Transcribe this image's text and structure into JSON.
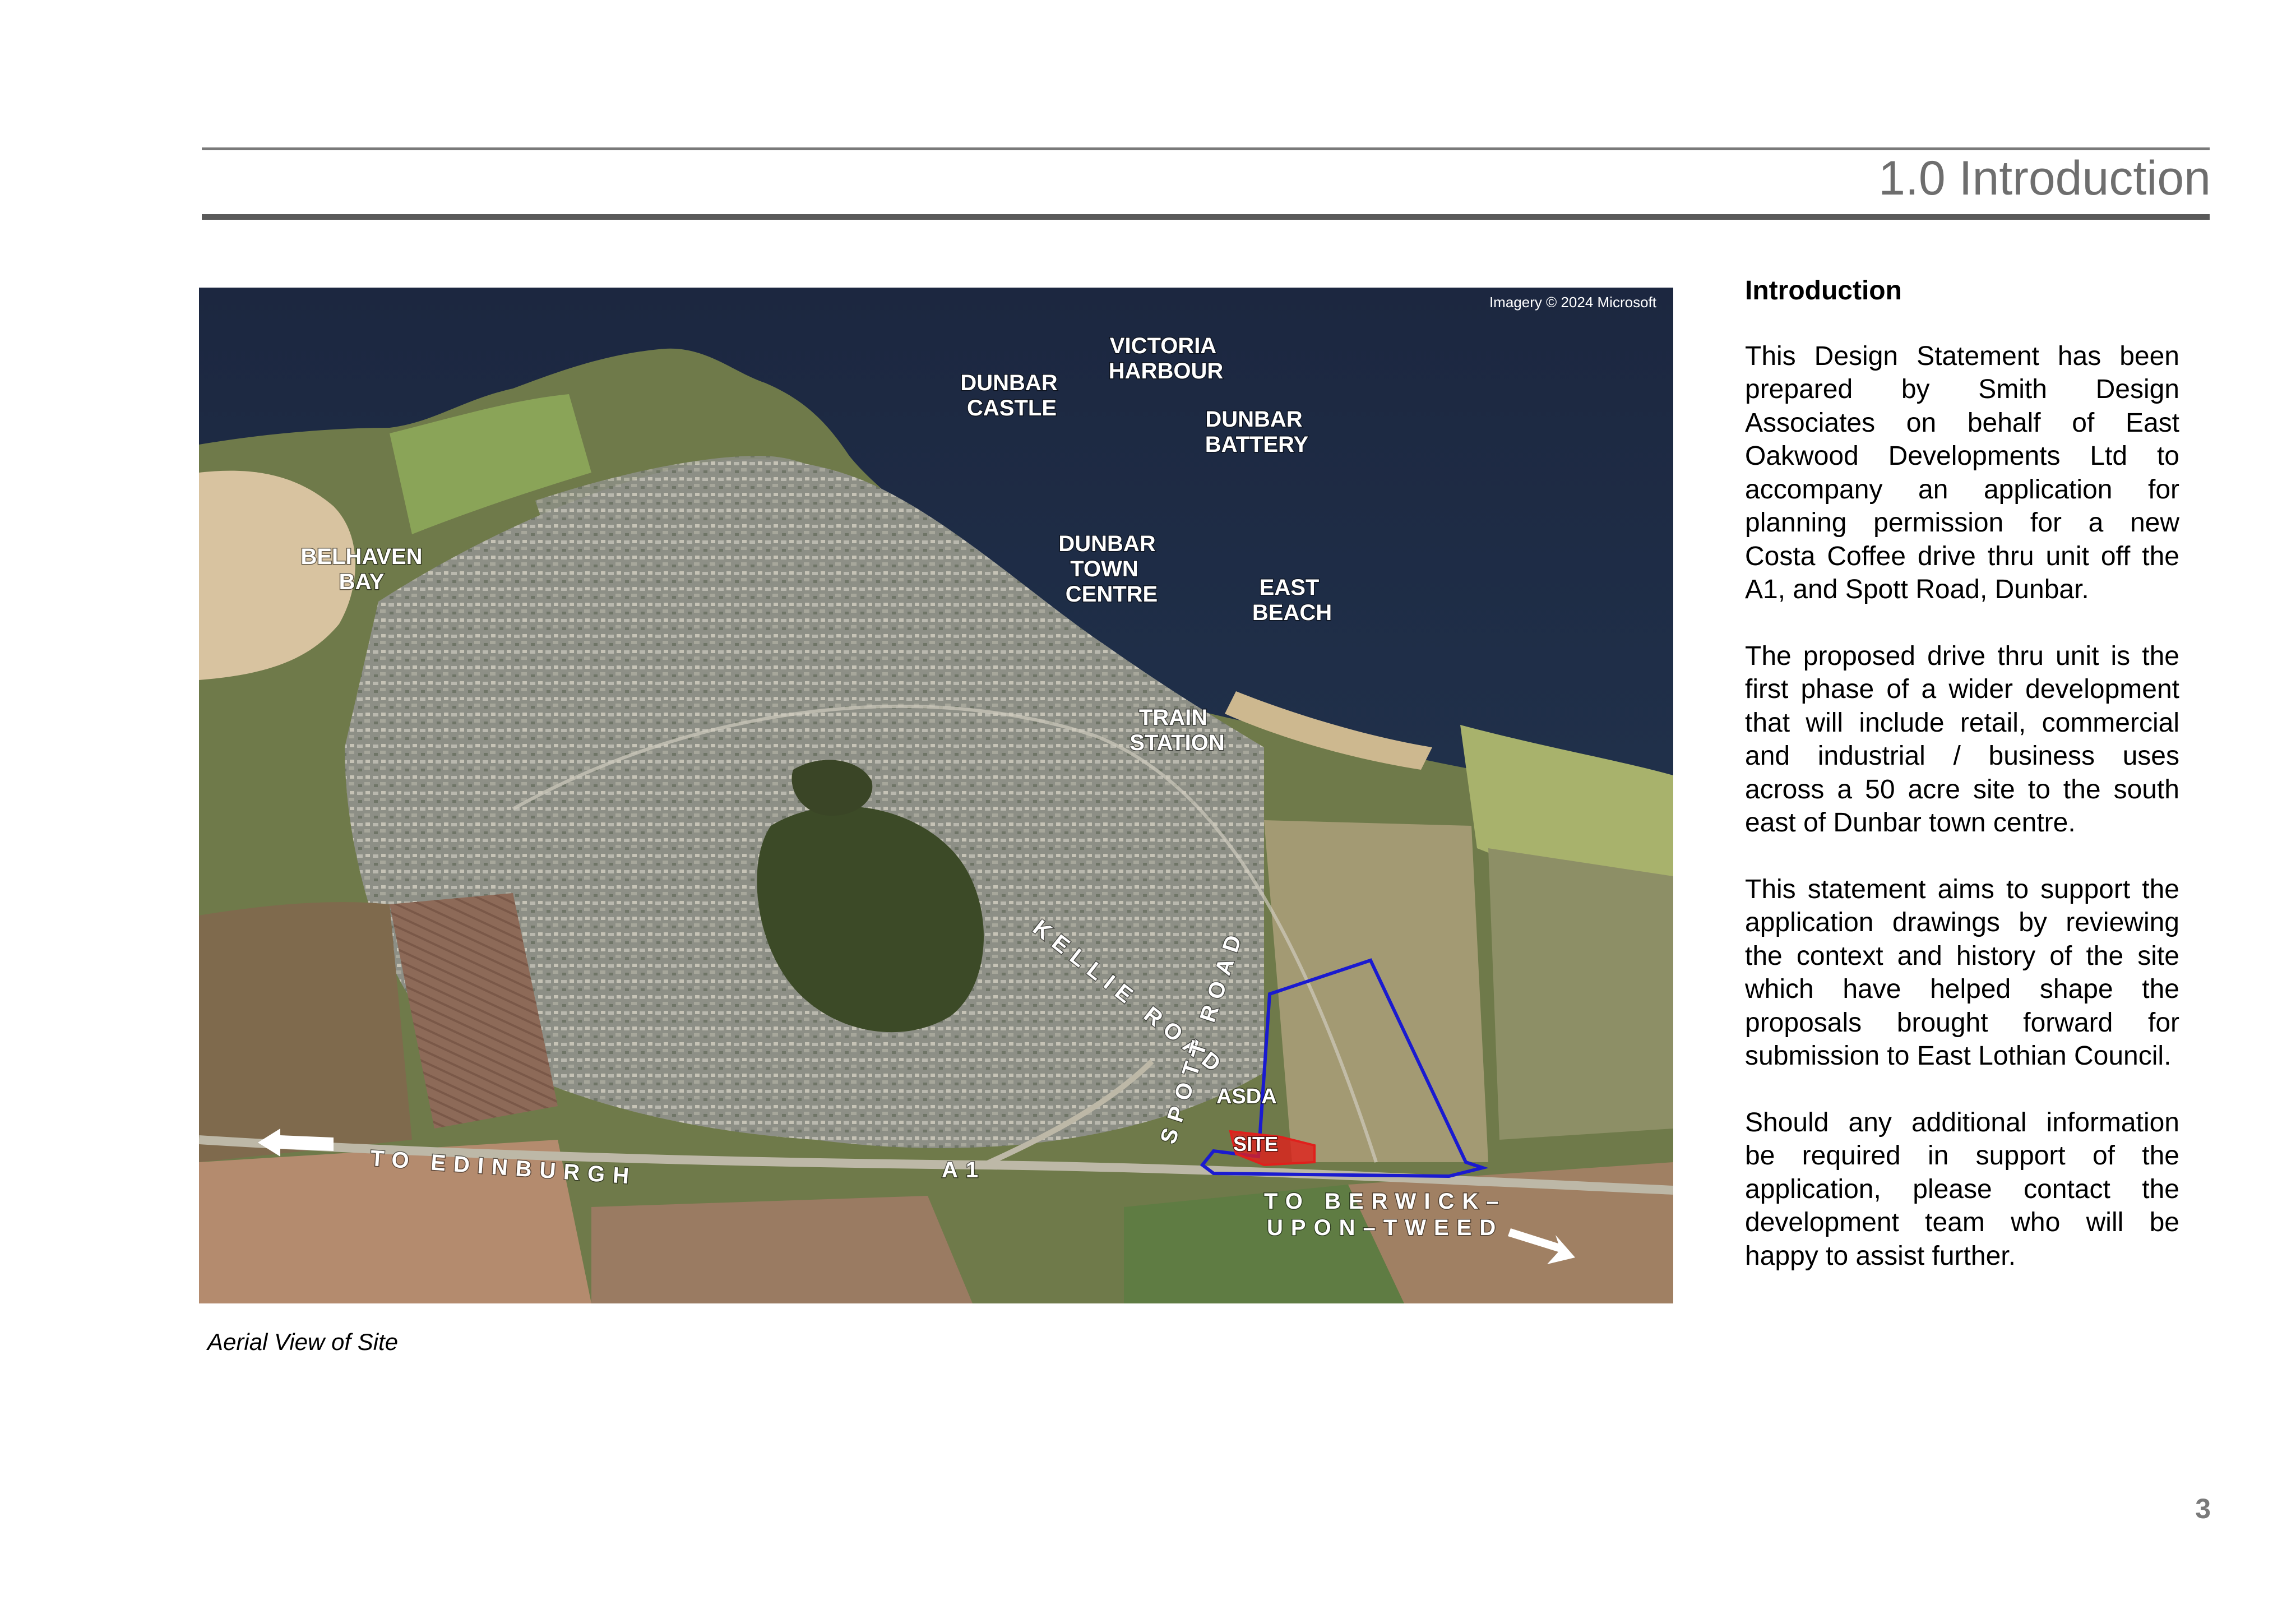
{
  "header": {
    "title": "1.0 Introduction"
  },
  "map": {
    "credit": "Imagery © 2024 Microsoft",
    "labels": {
      "victoria_harbour_1": "VICTORIA",
      "victoria_harbour_2": "HARBOUR",
      "dunbar_castle_1": "DUNBAR",
      "dunbar_castle_2": "CASTLE",
      "dunbar_battery_1": "DUNBAR",
      "dunbar_battery_2": "BATTERY",
      "belhaven_1": "BELHAVEN",
      "belhaven_2": "BAY",
      "town_centre_1": "DUNBAR",
      "town_centre_2": "TOWN",
      "town_centre_3": "CENTRE",
      "east_beach_1": "EAST",
      "east_beach_2": "BEACH",
      "train_station_1": "TRAIN",
      "train_station_2": "STATION",
      "kellie_road": "KELLIE ROAD",
      "spott_road": "SPOTT ROAD",
      "asda": "ASDA",
      "site": "SITE",
      "to_edinburgh": "TO EDINBURGH",
      "a1": "A1",
      "to_berwick_1": "TO BERWICK–",
      "to_berwick_2": "UPON–TWEED"
    },
    "colors": {
      "sea": "#1f2b45",
      "site_red": "#e0201c",
      "boundary_blue": "#1a1ad0"
    }
  },
  "caption": "Aerial View of Site",
  "content": {
    "heading": "Introduction",
    "paragraphs": [
      "This Design Statement has been prepared by Smith Design Associates on behalf  of East Oakwood Developments Ltd to accompany an application for planning permission for a new Costa Coffee drive thru unit off the A1, and Spott Road, Dunbar.",
      "The proposed drive thru unit is the first phase of a wider development that will include retail, commercial and industrial / business uses across a 50 acre site to the south east of Dunbar town centre.",
      "This statement aims to support the application drawings by reviewing the context and history of the site which have helped shape the proposals brought forward for submission to East Lothian Council.",
      "Should any additional information be required in support of the application, please contact the development team who will be happy to assist further."
    ]
  },
  "page_number": "3"
}
